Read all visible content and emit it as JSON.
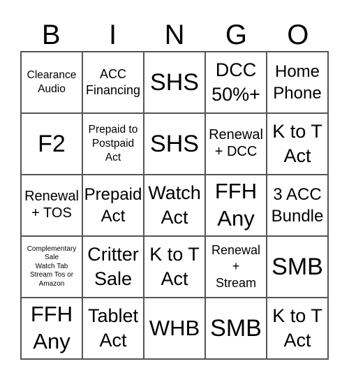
{
  "header": {
    "letters": [
      "B",
      "I",
      "N",
      "G",
      "O"
    ]
  },
  "card": {
    "cells": [
      "Clearance\nAudio",
      "ACC\nFinancing",
      "SHS",
      "DCC\n50%+",
      "Home\nPhone",
      "F2",
      "Prepaid to\nPostpaid\nAct",
      "SHS",
      "Renewal\n+ DCC",
      "K to T\nAct",
      "Renewal\n+ TOS",
      "Prepaid\nAct",
      "Watch\nAct",
      "FFH\nAny",
      "3 ACC\nBundle",
      "Complementary\nSale\nWatch Tab\nStream Tos or\nAmazon",
      "Critter\nSale",
      "K to T\nAct",
      "Renewal\n+\nStream",
      "SMB",
      "FFH\nAny",
      "Tablet\nAct",
      "WHB",
      "SMB",
      "K to T\nAct"
    ]
  }
}
